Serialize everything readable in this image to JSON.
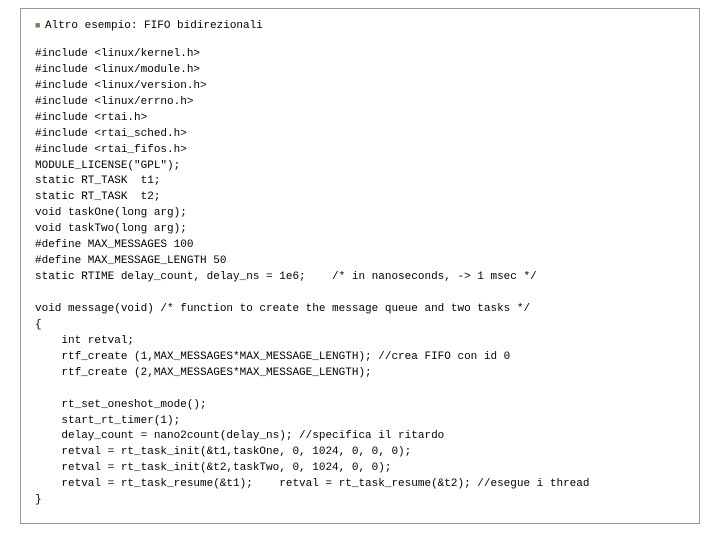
{
  "title": "Altro esempio: FIFO bidirezionali",
  "code": {
    "l1": "#include <linux/kernel.h>",
    "l2": "#include <linux/module.h>",
    "l3": "#include <linux/version.h>",
    "l4": "#include <linux/errno.h>",
    "l5": "#include <rtai.h>",
    "l6": "#include <rtai_sched.h>",
    "l7": "#include <rtai_fifos.h>",
    "l8": "MODULE_LICENSE(\"GPL\");",
    "l9": "static RT_TASK  t1;",
    "l10": "static RT_TASK  t2;",
    "l11": "void taskOne(long arg);",
    "l12": "void taskTwo(long arg);",
    "l13": "#define MAX_MESSAGES 100",
    "l14": "#define MAX_MESSAGE_LENGTH 50",
    "l15": "static RTIME delay_count, delay_ns = 1e6;    /* in nanoseconds, -> 1 msec */",
    "l16": "",
    "l17": "void message(void) /* function to create the message queue and two tasks */",
    "l18": "{",
    "l19": "    int retval;",
    "l20": "    rtf_create (1,MAX_MESSAGES*MAX_MESSAGE_LENGTH); //crea FIFO con id 0",
    "l21": "    rtf_create (2,MAX_MESSAGES*MAX_MESSAGE_LENGTH);",
    "l22": "",
    "l23": "    rt_set_oneshot_mode();",
    "l24": "    start_rt_timer(1);",
    "l25": "    delay_count = nano2count(delay_ns); //specifica il ritardo",
    "l26": "    retval = rt_task_init(&t1,taskOne, 0, 1024, 0, 0, 0);",
    "l27": "    retval = rt_task_init(&t2,taskTwo, 0, 1024, 0, 0);",
    "l28": "    retval = rt_task_resume(&t1);    retval = rt_task_resume(&t2); //esegue i thread",
    "l29": "}"
  }
}
